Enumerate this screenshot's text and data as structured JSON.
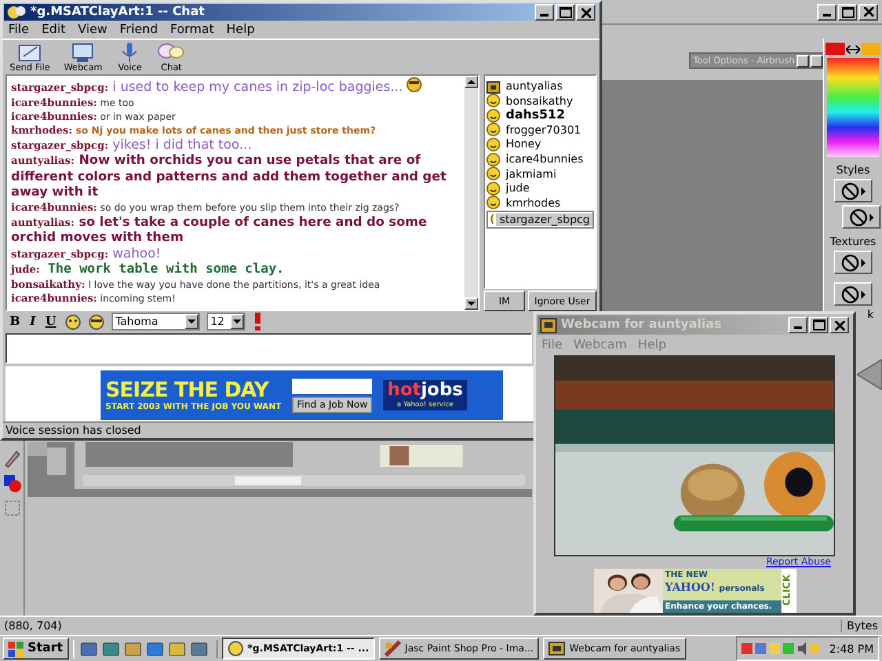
{
  "paint_shop": {
    "tool_options_title": "Tool Options - Airbrush",
    "palette_labels": [
      "Styles",
      "Textures",
      "k"
    ],
    "status_position": "(880, 704)",
    "status_right": "Bytes"
  },
  "chat_window": {
    "title": "*g.MSATClayArt:1 -- Chat",
    "menu": [
      "File",
      "Edit",
      "View",
      "Friend",
      "Format",
      "Help"
    ],
    "toolbar": [
      {
        "label": "Send File",
        "kind": "file"
      },
      {
        "label": "Webcam",
        "kind": "webcam"
      },
      {
        "label": "Voice",
        "kind": "voice"
      },
      {
        "label": "Chat",
        "kind": "chat"
      }
    ],
    "messages": [
      {
        "name": "stargazer_sbpcg:",
        "text": "i used to keep my canes in zip-loc baggies...",
        "kind": "large",
        "color": "#8a5cc8",
        "emoticon": true
      },
      {
        "name": "icare4bunnies:",
        "text": "me too",
        "kind": "small",
        "color": "#333333",
        "emoticon": false
      },
      {
        "name": "icare4bunnies:",
        "text": "or in wax paper",
        "kind": "small",
        "color": "#333333",
        "emoticon": false
      },
      {
        "name": "kmrhodes:",
        "text": "so Nj you make lots of canes and then just store them?",
        "kind": "bold-small",
        "color": "#b86418",
        "emoticon": false
      },
      {
        "name": "stargazer_sbpcg:",
        "text": "yikes! i did that too...",
        "kind": "large",
        "color": "#8a5cc8",
        "emoticon": false
      },
      {
        "name": "auntyalias:",
        "text": "Now with orchids you can use petals that are of different colors and patterns and add them together and get away with it",
        "kind": "bold-large",
        "color": "#7a1040",
        "emoticon": false
      },
      {
        "name": "icare4bunnies:",
        "text": "so do you wrap them before you slip them into their zig zags?",
        "kind": "small",
        "color": "#333333",
        "emoticon": false
      },
      {
        "name": "auntyalias:",
        "text": "so let's take a couple of canes here and do some orchid moves with them",
        "kind": "bold-large",
        "color": "#7a1040",
        "emoticon": false
      },
      {
        "name": "stargazer_sbpcg:",
        "text": "wahoo!",
        "kind": "large",
        "color": "#8a5cc8",
        "emoticon": false
      },
      {
        "name": "jude:",
        "text": "The work table with some clay.",
        "kind": "script",
        "color": "#1f6a2e",
        "emoticon": false
      },
      {
        "name": "bonsaikathy:",
        "text": "I love the way you have done the partitions, it's a great idea",
        "kind": "small",
        "color": "#333333",
        "emoticon": false
      },
      {
        "name": "icare4bunnies:",
        "text": "incoming stem!",
        "kind": "small",
        "color": "#333333",
        "emoticon": false
      }
    ],
    "users": [
      {
        "name": "auntyalias",
        "kind": "webcam",
        "bold": false,
        "selected": false
      },
      {
        "name": "bonsaikathy",
        "kind": "smiley",
        "bold": false,
        "selected": false
      },
      {
        "name": "dahs512",
        "kind": "smiley",
        "bold": true,
        "selected": false
      },
      {
        "name": "frogger70301",
        "kind": "smiley",
        "bold": false,
        "selected": false
      },
      {
        "name": "Honey",
        "kind": "smiley",
        "bold": false,
        "selected": false
      },
      {
        "name": "icare4bunnies",
        "kind": "smiley",
        "bold": false,
        "selected": false
      },
      {
        "name": "jakmiami",
        "kind": "smiley",
        "bold": false,
        "selected": false
      },
      {
        "name": "jude",
        "kind": "smiley",
        "bold": false,
        "selected": false
      },
      {
        "name": "kmrhodes",
        "kind": "smiley",
        "bold": false,
        "selected": false
      },
      {
        "name": "stargazer_sbpcg",
        "kind": "smiley",
        "bold": false,
        "selected": true
      }
    ],
    "user_buttons": [
      "IM",
      "Ignore User"
    ],
    "format_bar": {
      "bold": "B",
      "italic": "I",
      "underline": "U",
      "font": "Tahoma",
      "size": "12"
    },
    "ad": {
      "headline": "SEIZE THE DAY",
      "subline": "START 2003 WITH THE JOB YOU WANT",
      "button": "Find a Job Now",
      "brand_hot": "hot",
      "brand_jobs": "jobs",
      "brand_note": "a Yahoo! service"
    },
    "status": "Voice session has closed"
  },
  "webcam_window": {
    "title": "Webcam for auntyalias",
    "menu": [
      "File",
      "Webcam",
      "Help"
    ],
    "report_link": "Report Abuse",
    "ad": {
      "line1": "THE NEW",
      "brand": "YAHOO!",
      "brand_word": "personals",
      "tagline": "Enhance your chances.",
      "click": "CLICK"
    }
  },
  "taskbar": {
    "start": "Start",
    "tasks": [
      {
        "label": "*g.MSATClayArt:1 -- ...",
        "kind": "chat",
        "selected": true
      },
      {
        "label": "Jasc Paint Shop Pro - Ima...",
        "kind": "paint",
        "selected": false
      },
      {
        "label": "Webcam for auntyalias",
        "kind": "webcam",
        "selected": false
      }
    ],
    "clock": "2:48 PM"
  }
}
